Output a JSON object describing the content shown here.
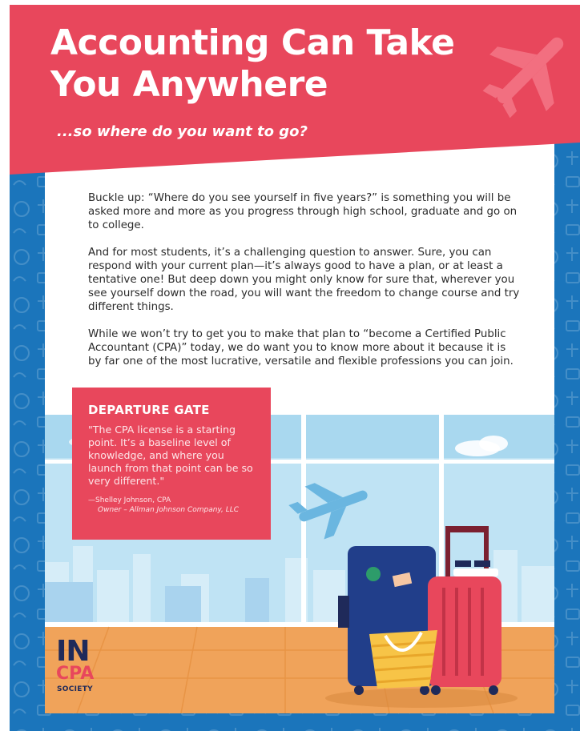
{
  "header": {
    "title_line1": "Accounting Can Take",
    "title_line2": "You Anywhere",
    "subtitle": "...so where do you want to go?",
    "icon": "airplane-icon"
  },
  "body": {
    "paragraphs": [
      "Buckle up: “Where do you see yourself in five years?” is something you will be asked more and more as you progress through high school, graduate and go on to college.",
      "And for most students, it’s a challenging question to answer. Sure, you can respond with your current plan—it’s always good to have a plan, or at least a tentative one! But deep down you might only know for sure that, wherever you see yourself down the road, you will want the freedom to change course and try different things.",
      "While we won’t try to get you to make that plan to “become a Certified Public Accountant (CPA)” today, we do want you to know more about it because it is by far one of the most lucrative, versatile and flexible professions you can join."
    ]
  },
  "quote": {
    "heading": "DEPARTURE GATE",
    "text": "\"The CPA license is a starting point. It’s a baseline level of knowledge, and where you launch from that point can be so very different.\"",
    "author": "—Shelley Johnson, CPA",
    "role": "Owner – Allman Johnson Company, LLC"
  },
  "logo": {
    "line1": "IN",
    "line2": "CPA",
    "line3": "SOCIETY"
  },
  "colors": {
    "brand_red": "#e8475c",
    "brand_blue": "#1b75bb",
    "navy": "#1f2a5a",
    "sky": "#bfe3f4",
    "floor": "#f0a35a"
  }
}
